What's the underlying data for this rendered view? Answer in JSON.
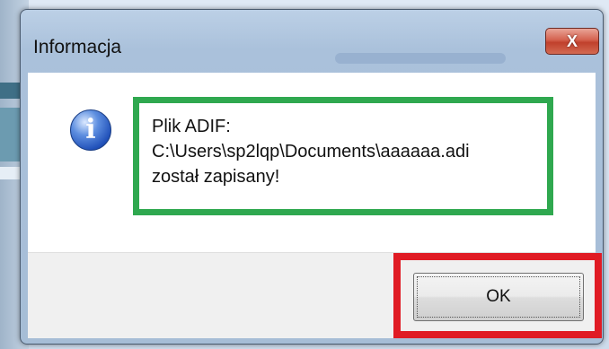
{
  "window": {
    "title": "Informacja",
    "close_label": "X"
  },
  "message": {
    "lines": [
      "Plik ADIF:",
      "C:\\Users\\sp2lqp\\Documents\\aaaaaa.adi",
      "został zapisany!"
    ]
  },
  "buttons": {
    "ok_label": "OK"
  },
  "icons": {
    "info": "info-icon",
    "close": "close-icon"
  },
  "colors": {
    "message_highlight": "#2fa84f",
    "button_highlight": "#e01b24",
    "info_icon_blue": "#1f4fb8",
    "close_button_red": "#c0402c"
  }
}
